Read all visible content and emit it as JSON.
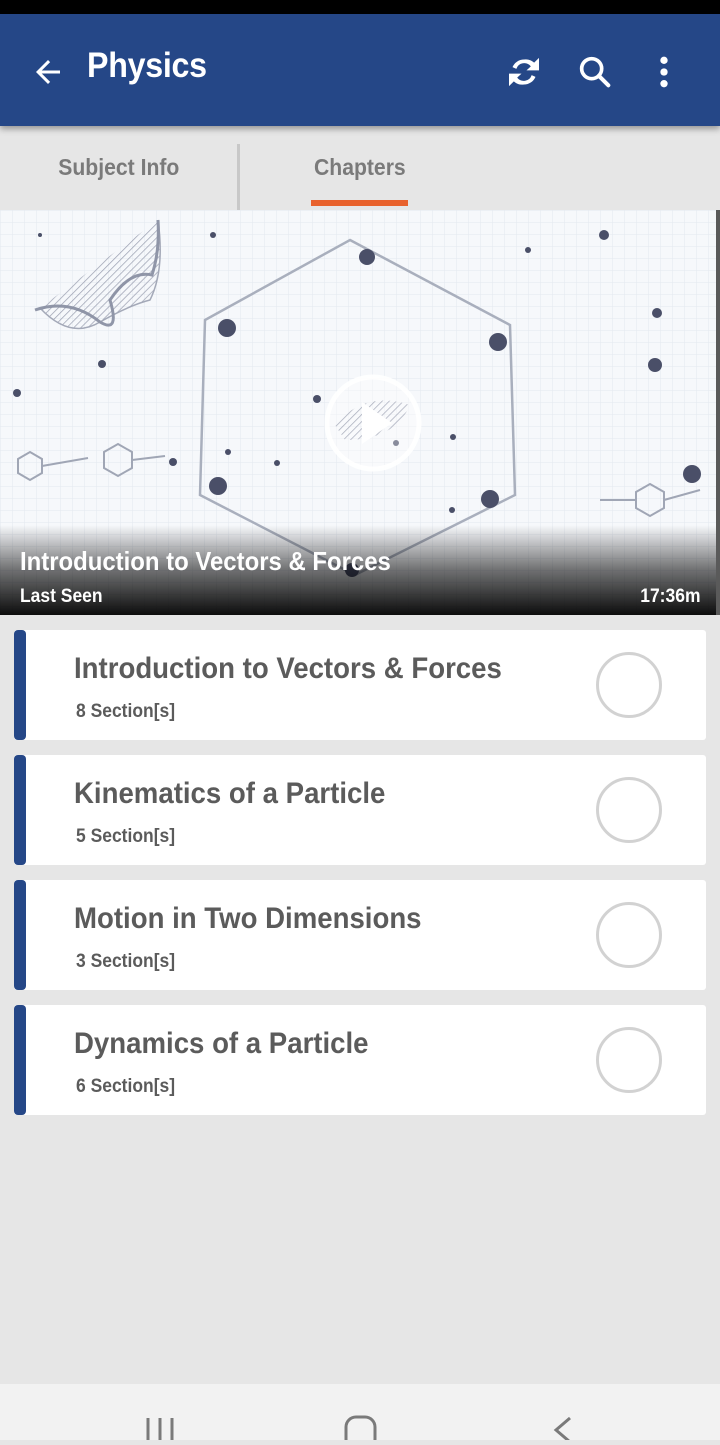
{
  "app_bar": {
    "title": "Physics",
    "back_icon": "arrow-left-icon",
    "actions": [
      {
        "name": "refresh",
        "icon": "refresh-icon"
      },
      {
        "name": "search",
        "icon": "search-icon"
      },
      {
        "name": "more",
        "icon": "more-vertical-icon"
      }
    ],
    "color": "#254787"
  },
  "tabs": [
    {
      "label": "Subject Info",
      "active": false
    },
    {
      "label": "Chapters",
      "active": true
    }
  ],
  "tab_indicator_color": "#e8612c",
  "last_seen_video": {
    "title": "Introduction to Vectors & Forces",
    "label": "Last Seen",
    "duration": "17:36m",
    "play_icon": "play-icon"
  },
  "chapters": [
    {
      "title": "Introduction to Vectors & Forces",
      "sections": "8 Section[s]",
      "completed": false
    },
    {
      "title": "Kinematics of a Particle",
      "sections": "5 Section[s]",
      "completed": false
    },
    {
      "title": "Motion in Two Dimensions",
      "sections": "3 Section[s]",
      "completed": false
    },
    {
      "title": "Dynamics of a Particle",
      "sections": "6 Section[s]",
      "completed": false
    }
  ],
  "system_nav": [
    {
      "name": "recents",
      "icon": "recents-icon"
    },
    {
      "name": "home",
      "icon": "home-icon"
    },
    {
      "name": "back",
      "icon": "back-chevron-icon"
    }
  ]
}
